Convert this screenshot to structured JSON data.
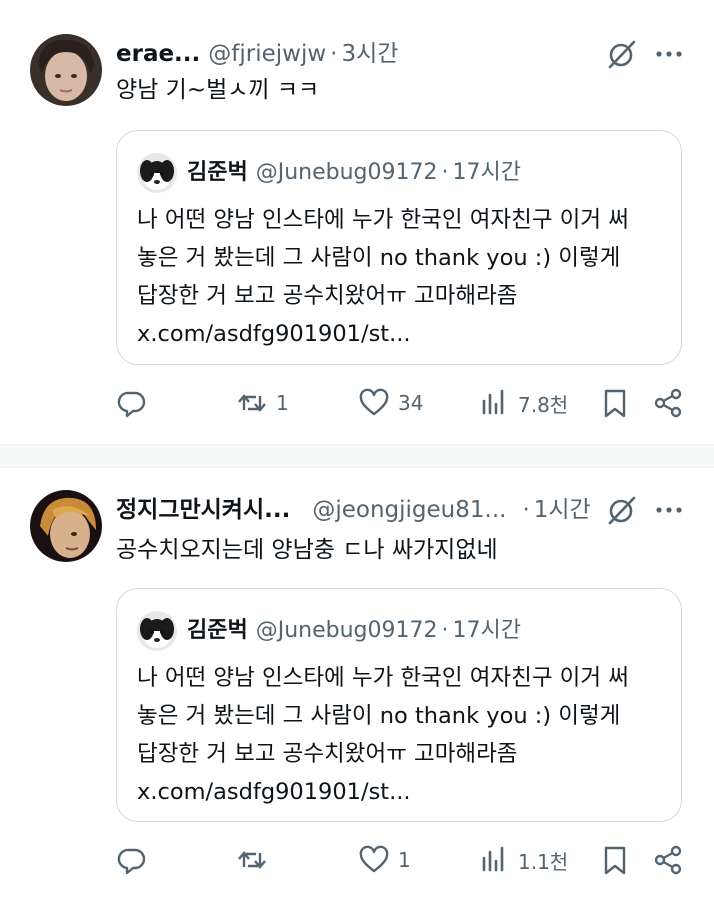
{
  "posts": [
    {
      "author_name": "erae...",
      "handle": "@fjriejwjw",
      "separator": "·",
      "time": "3시간",
      "text": "양남 기~벌ㅅ끼 ㅋㅋ",
      "quote": {
        "author_name": "김준벅",
        "handle": "@Junebug09172",
        "separator": "·",
        "time": "17시간",
        "lines": [
          "나 어떤 양남 인스타에 누가 한국인 여자친구 이거 써",
          "놓은 거 봤는데 그 사람이 no thank you :) 이렇게",
          "답장한 거 보고 공수치왔어ㅠ 고마해라좀",
          "x.com/asdfg901901/st..."
        ]
      },
      "actions": {
        "replies": "",
        "reposts": "1",
        "likes": "34",
        "views": "7.8천"
      }
    },
    {
      "author_name": "정지그만시켜시...",
      "handle": "@jeongjigeu81...",
      "separator": "·",
      "time": "1시간",
      "text": "공수치오지는데 양남충 ㄷ나 싸가지없네",
      "quote": {
        "author_name": "김준벅",
        "handle": "@Junebug09172",
        "separator": "·",
        "time": "17시간",
        "lines": [
          "나 어떤 양남 인스타에 누가 한국인 여자친구 이거 써",
          "놓은 거 봤는데 그 사람이 no thank you :) 이렇게",
          "답장한 거 보고 공수치왔어ㅠ 고마해라좀",
          "x.com/asdfg901901/st..."
        ]
      },
      "actions": {
        "replies": "",
        "reposts": "",
        "likes": "1",
        "views": "1.1천"
      }
    }
  ],
  "icons": {
    "more": "more-icon",
    "grok": "grok-icon",
    "reply": "reply-icon",
    "repost": "repost-icon",
    "like": "like-icon",
    "views": "views-icon",
    "bookmark": "bookmark-icon",
    "share": "share-icon"
  },
  "colors": {
    "text": "#0f1419",
    "muted": "#536471",
    "border": "#cfd9de"
  }
}
